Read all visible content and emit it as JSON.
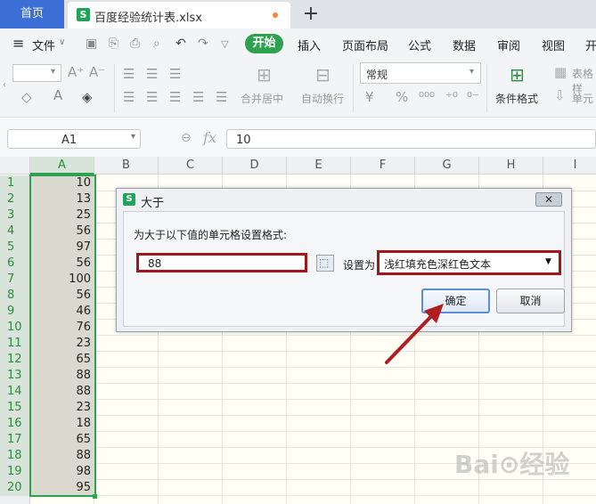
{
  "tabs": {
    "home_label": "首页",
    "file_label": "百度经验统计表.xlsx",
    "add_icon": "plus-icon"
  },
  "menu": {
    "file_label": "文件",
    "items": [
      "开始",
      "插入",
      "页面布局",
      "公式",
      "数据",
      "审阅",
      "视图",
      "开"
    ]
  },
  "ribbon": {
    "merge_label": "合并居中",
    "wrap_label": "自动换行",
    "number_format": "常规",
    "conditional_label": "条件格式",
    "table_label": "表格样",
    "cell_label": "单元"
  },
  "formula_bar": {
    "name_box": "A1",
    "fx_label": "fx",
    "value": "10"
  },
  "sheet": {
    "columns": [
      "A",
      "B",
      "C",
      "D",
      "E",
      "F",
      "G",
      "H",
      "I"
    ],
    "rows": [
      "1",
      "2",
      "3",
      "4",
      "5",
      "6",
      "7",
      "8",
      "9",
      "10",
      "11",
      "12",
      "13",
      "14",
      "15",
      "16",
      "17",
      "18",
      "19",
      "20"
    ],
    "column_a_values": [
      "10",
      "13",
      "25",
      "56",
      "97",
      "56",
      "100",
      "56",
      "46",
      "76",
      "23",
      "65",
      "88",
      "88",
      "23",
      "18",
      "65",
      "88",
      "98",
      "95"
    ]
  },
  "dialog": {
    "title": "大于",
    "close_label": "✕",
    "prompt": "为大于以下值的单元格设置格式:",
    "input_value": "88",
    "set_as_label": "设置为",
    "format_option": "浅红填充色深红色文本",
    "ok_label": "确定",
    "cancel_label": "取消"
  },
  "colors": {
    "accent_green": "#2fa24f",
    "highlight_red": "#a3141b",
    "tab_blue": "#3b6fd6"
  }
}
